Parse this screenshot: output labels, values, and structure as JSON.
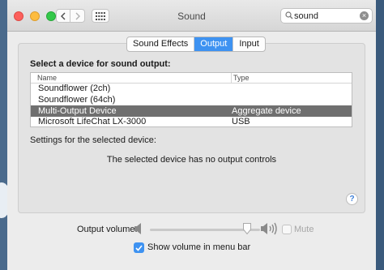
{
  "window": {
    "title": "Sound"
  },
  "search": {
    "value": "sound"
  },
  "tabs": [
    {
      "label": "Sound Effects",
      "active": false
    },
    {
      "label": "Output",
      "active": true
    },
    {
      "label": "Input",
      "active": false
    }
  ],
  "output": {
    "section_label": "Select a device for sound output:",
    "columns": [
      "Name",
      "Type"
    ],
    "devices": [
      {
        "name": "Soundflower (2ch)",
        "type": "",
        "selected": false
      },
      {
        "name": "Soundflower (64ch)",
        "type": "",
        "selected": false
      },
      {
        "name": "Multi-Output Device",
        "type": "Aggregate device",
        "selected": true
      },
      {
        "name": "Microsoft LifeChat LX-3000",
        "type": "USB",
        "selected": false
      }
    ],
    "settings_label": "Settings for the selected device:",
    "no_controls_text": "The selected device has no output controls"
  },
  "help": {
    "label": "?"
  },
  "volume": {
    "label": "Output volume:",
    "level": 0.88,
    "mute_label": "Mute",
    "mute_checked": false,
    "mute_enabled": false
  },
  "menu_bar": {
    "label": "Show volume in menu bar",
    "checked": true
  },
  "colors": {
    "accent": "#3e92f1",
    "selected_row": "#6f6f6f"
  },
  "icons": [
    "back-arrow-icon",
    "forward-arrow-icon",
    "grid-icon",
    "magnifier-icon",
    "clear-icon",
    "speaker-low-icon",
    "speaker-high-icon",
    "checkmark-icon",
    "help-icon"
  ]
}
